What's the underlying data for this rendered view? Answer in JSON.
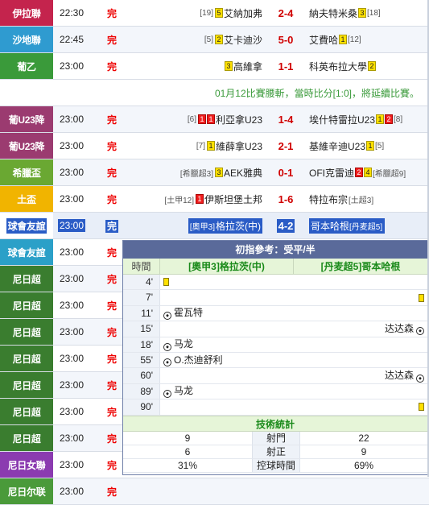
{
  "rows": [
    {
      "league": "伊拉聯",
      "color": "#c4244d",
      "time": "22:30",
      "status": "完",
      "home_rank": "[19]",
      "home_cards": [
        {
          "t": "y",
          "n": "5"
        }
      ],
      "home": "艾納加弗",
      "score": "2-4",
      "away": "納夫特米桑",
      "away_cards": [
        {
          "t": "y",
          "n": "3"
        }
      ],
      "away_rank": "[18]"
    },
    {
      "league": "沙地聯",
      "color": "#2f9bd0",
      "time": "22:45",
      "status": "完",
      "home_rank": "[5]",
      "home_cards": [
        {
          "t": "y",
          "n": "2"
        }
      ],
      "home": "艾卡迪沙",
      "score": "5-0",
      "away": "艾費哈",
      "away_cards": [
        {
          "t": "y",
          "n": "1"
        }
      ],
      "away_rank": "[12]"
    },
    {
      "league": "葡乙",
      "color": "#3a9a3a",
      "time": "23:00",
      "status": "完",
      "home_rank": "",
      "home_cards": [
        {
          "t": "y",
          "n": "3"
        }
      ],
      "home": "高維拿",
      "score": "1-1",
      "away": "科英布拉大學",
      "away_cards": [
        {
          "t": "y",
          "n": "2"
        }
      ],
      "away_rank": ""
    }
  ],
  "notice": "01月12比賽腰斬，當時比分[1:0]，將延續比賽。",
  "rows2": [
    {
      "league": "葡U23降",
      "color": "#9b3b70",
      "time": "23:00",
      "status": "完",
      "home_rank": "[6]",
      "home_cards": [
        {
          "t": "r",
          "n": "1"
        },
        {
          "t": "r",
          "n": "1"
        }
      ],
      "home": "利亞拿U23",
      "score": "1-4",
      "away": "埃什特雷拉U23",
      "away_cards": [
        {
          "t": "y",
          "n": "1"
        },
        {
          "t": "r",
          "n": "2"
        }
      ],
      "away_rank": "[8]"
    },
    {
      "league": "葡U23降",
      "color": "#9b3b70",
      "time": "23:00",
      "status": "完",
      "home_rank": "[7]",
      "home_cards": [
        {
          "t": "y",
          "n": "1"
        }
      ],
      "home": "維薛拿U23",
      "score": "2-1",
      "away": "基維辛迪U23",
      "away_cards": [
        {
          "t": "y",
          "n": "1"
        }
      ],
      "away_rank": "[5]"
    },
    {
      "league": "希臘盃",
      "color": "#6aa832",
      "time": "23:00",
      "status": "完",
      "home_rank": "[希臘超3]",
      "home_cards": [
        {
          "t": "y",
          "n": "3"
        }
      ],
      "home": "AEK雅典",
      "score": "0-1",
      "away": "OFI克雷迪",
      "away_cards": [
        {
          "t": "r",
          "n": "2"
        },
        {
          "t": "y",
          "n": "4"
        }
      ],
      "away_rank": "[希臘超9]"
    },
    {
      "league": "土盃",
      "color": "#f1b400",
      "time": "23:00",
      "status": "完",
      "home_rank": "[土甲12]",
      "home_cards": [
        {
          "t": "r",
          "n": "1"
        }
      ],
      "home": "伊斯坦堡土邦",
      "score": "1-6",
      "away": "特拉布宗",
      "away_cards": [],
      "away_rank": "[土超3]"
    }
  ],
  "selected": {
    "league": "球會友誼",
    "color": "#2ba0c8",
    "time": "23:00",
    "status": "完",
    "home_rank": "[奧甲3]",
    "home": "格拉茨(中)",
    "score": "4-2",
    "away": "哥本哈根",
    "away_rank": "[丹麦超5]"
  },
  "rows3": [
    {
      "league": "球會友誼",
      "color": "#2ba0c8",
      "time": "23:00",
      "status": "完"
    },
    {
      "league": "尼日超",
      "color": "#3a7d2f",
      "time": "23:00",
      "status": "完"
    },
    {
      "league": "尼日超",
      "color": "#3a7d2f",
      "time": "23:00",
      "status": "完"
    },
    {
      "league": "尼日超",
      "color": "#3a7d2f",
      "time": "23:00",
      "status": "完"
    },
    {
      "league": "尼日超",
      "color": "#3a7d2f",
      "time": "23:00",
      "status": "完"
    },
    {
      "league": "尼日超",
      "color": "#3a7d2f",
      "time": "23:00",
      "status": "完"
    },
    {
      "league": "尼日超",
      "color": "#3a7d2f",
      "time": "23:00",
      "status": "完"
    },
    {
      "league": "尼日超",
      "color": "#3a7d2f",
      "time": "23:00",
      "status": "完"
    },
    {
      "league": "尼日女聯",
      "color": "#8b3bb0",
      "time": "23:00",
      "status": "完"
    },
    {
      "league": "尼日尔联",
      "color": "#4a9a3a",
      "time": "23:00",
      "status": "完"
    }
  ],
  "popup": {
    "title": "初指參考：受平/半",
    "col_time": "時間",
    "home_team": "[奧甲3]格拉茨(中)",
    "away_team": "[丹麦超5]哥本哈根",
    "events": [
      {
        "min": "4'",
        "home": "",
        "home_icon": "ycard",
        "away": "",
        "away_icon": ""
      },
      {
        "min": "7'",
        "home": "",
        "home_icon": "",
        "away": "",
        "away_icon": "ycard"
      },
      {
        "min": "11'",
        "home": "霍瓦特",
        "home_icon": "ball",
        "away": "",
        "away_icon": ""
      },
      {
        "min": "15'",
        "home": "",
        "home_icon": "",
        "away": "达达森",
        "away_icon": "ball"
      },
      {
        "min": "18'",
        "home": "马龙",
        "home_icon": "ball",
        "away": "",
        "away_icon": ""
      },
      {
        "min": "55'",
        "home": "O.杰迪舒利",
        "home_icon": "ball",
        "away": "",
        "away_icon": ""
      },
      {
        "min": "60'",
        "home": "",
        "home_icon": "",
        "away": "达达森",
        "away_icon": "ball"
      },
      {
        "min": "89'",
        "home": "马龙",
        "home_icon": "ball",
        "away": "",
        "away_icon": ""
      },
      {
        "min": "90'",
        "home": "",
        "home_icon": "",
        "away": "",
        "away_icon": "ycard"
      }
    ],
    "stats_title": "技術統計",
    "stats": [
      {
        "home": "9",
        "label": "射門",
        "away": "22"
      },
      {
        "home": "6",
        "label": "射正",
        "away": "9"
      },
      {
        "home": "31%",
        "label": "控球時間",
        "away": "69%"
      }
    ]
  }
}
